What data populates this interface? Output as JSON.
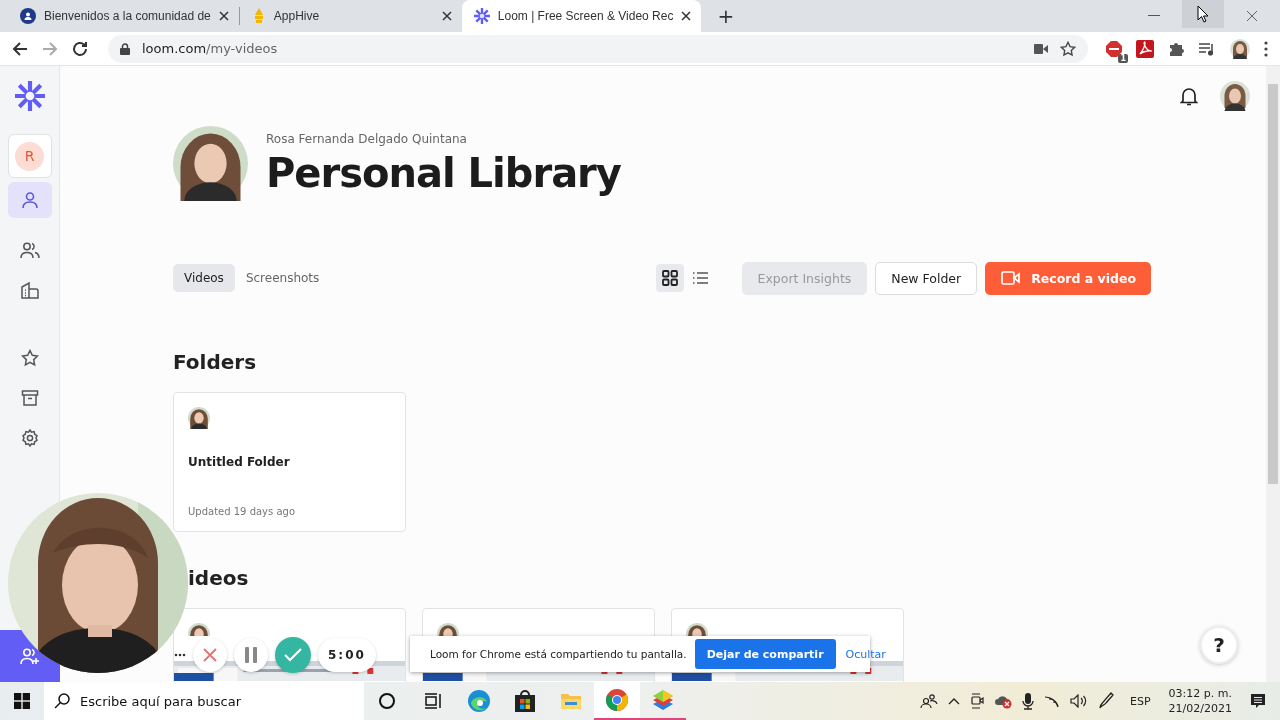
{
  "browser": {
    "tabs": [
      {
        "title": "Bienvenidos a la comunidad de",
        "selected": false
      },
      {
        "title": "AppHive",
        "selected": false
      },
      {
        "title": "Loom | Free Screen & Video Rec",
        "selected": true
      }
    ],
    "new_tab": "+",
    "address": {
      "host": "loom.com",
      "path": "/my-videos"
    },
    "extension_badge": "1"
  },
  "sidebar": {
    "workspace": "R",
    "nav": [
      {
        "kind": "person",
        "selected": true
      },
      {
        "kind": "people",
        "selected": false
      },
      {
        "kind": "building",
        "selected": false
      }
    ],
    "bottom": [
      {
        "kind": "star",
        "selected": false
      },
      {
        "kind": "archive",
        "selected": false
      },
      {
        "kind": "settings",
        "selected": false
      }
    ]
  },
  "header": {
    "user_name": "Rosa Fernanda Delgado Quintana",
    "title": "Personal Library"
  },
  "view_tabs": [
    {
      "label": "Videos",
      "selected": true
    },
    {
      "label": "Screenshots",
      "selected": false
    }
  ],
  "view_modes": [
    {
      "kind": "grid",
      "selected": true
    },
    {
      "kind": "list",
      "selected": false
    }
  ],
  "actions": [
    {
      "kind": "secondary",
      "label": "Export Insights",
      "disabled": true
    },
    {
      "kind": "secondary",
      "label": "New Folder",
      "disabled": false
    },
    {
      "kind": "primary",
      "label": "Record a video",
      "disabled": false
    }
  ],
  "folders": {
    "heading": "Folders",
    "items": [
      {
        "name": "Untitled Folder",
        "updated": "Updated 19 days ago"
      }
    ]
  },
  "videos": {
    "heading": "ideos"
  },
  "recorder": {
    "timer": "5:00"
  },
  "share_bar": {
    "message": "Loom for Chrome está compartiendo tu pantalla.",
    "stop": "Dejar de compartir",
    "hide": "Ocultar"
  },
  "help": "?",
  "taskbar": {
    "search_placeholder": "Escribe aquí para buscar",
    "apps": [
      {
        "kind": "cortana",
        "selected": false,
        "running": false
      },
      {
        "kind": "taskview",
        "selected": false,
        "running": false
      },
      {
        "kind": "edge",
        "selected": false,
        "running": false
      },
      {
        "kind": "store",
        "selected": false,
        "running": false
      },
      {
        "kind": "explorer",
        "selected": false,
        "running": false
      },
      {
        "kind": "chrome",
        "selected": true,
        "running": true
      },
      {
        "kind": "bluestacks",
        "selected": false,
        "running": true
      }
    ],
    "language": "ESP",
    "time": "03:12 p. m.",
    "date": "21/02/2021"
  }
}
